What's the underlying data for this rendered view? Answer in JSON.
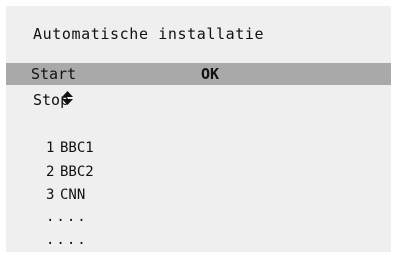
{
  "screen": {
    "title": "Automatische installatie"
  },
  "menu": {
    "items": [
      {
        "label": "Start",
        "selected": true,
        "status": "OK"
      },
      {
        "label": "Stop",
        "selected": false
      }
    ]
  },
  "icons": {
    "selector": "up-down-arrows-icon"
  },
  "channels": [
    {
      "number": "1",
      "name": "BBC1"
    },
    {
      "number": "2",
      "name": "BBC2"
    },
    {
      "number": "3",
      "name": "CNN"
    }
  ],
  "more_rows": [
    "....",
    "...."
  ],
  "colors": {
    "panel": "#efefef",
    "highlight": "#a9a9a9",
    "text": "#111111"
  }
}
